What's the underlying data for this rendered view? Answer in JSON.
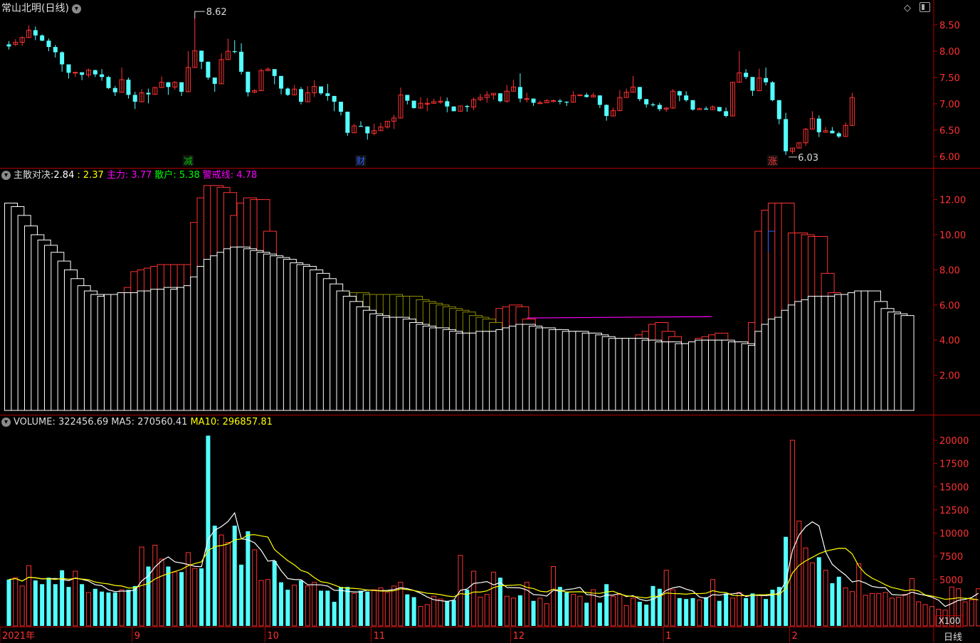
{
  "window": {
    "stock_title": "常山北明(日线)",
    "period_label": "日线",
    "scale_label": "X100"
  },
  "colors": {
    "up": "#ff3232",
    "down": "#54ffff",
    "grid": "#b00000",
    "white": "#ffffff",
    "yellow": "#ffff00",
    "magenta": "#ff00ff",
    "olive": "#8b8b00"
  },
  "price_panel": {
    "high_marker": "8.62",
    "low_marker": "6.03",
    "axis_ticks": [
      "8.50",
      "8.00",
      "7.50",
      "7.00",
      "6.50",
      "6.00"
    ],
    "event_labels": [
      {
        "text": "减",
        "color": "#00c000"
      },
      {
        "text": "财",
        "color": "#3060ff"
      },
      {
        "text": "涨",
        "color": "#ff3232"
      }
    ],
    "candles": [
      [
        8.13,
        8.09,
        8.19,
        8.03
      ],
      [
        8.13,
        8.17,
        8.23,
        8.1
      ],
      [
        8.17,
        8.26,
        8.28,
        8.1
      ],
      [
        8.26,
        8.4,
        8.49,
        8.36
      ],
      [
        8.4,
        8.3,
        8.47,
        8.21
      ],
      [
        8.3,
        8.2,
        8.32,
        8.19
      ],
      [
        8.2,
        8.08,
        8.24,
        8.0
      ],
      [
        8.08,
        7.98,
        8.12,
        7.88
      ],
      [
        7.98,
        7.75,
        8.0,
        7.61
      ],
      [
        7.75,
        7.59,
        7.73,
        7.48
      ],
      [
        7.59,
        7.6,
        7.61,
        7.51
      ],
      [
        7.6,
        7.55,
        7.58,
        7.45
      ],
      [
        7.55,
        7.64,
        7.67,
        7.5
      ],
      [
        7.64,
        7.56,
        7.65,
        7.51
      ],
      [
        7.56,
        7.51,
        7.66,
        7.44
      ],
      [
        7.51,
        7.3,
        7.53,
        7.28
      ],
      [
        7.3,
        7.22,
        7.34,
        7.15
      ],
      [
        7.22,
        7.46,
        7.69,
        7.43
      ],
      [
        7.46,
        7.17,
        7.5,
        7.1
      ],
      [
        7.17,
        7.04,
        7.23,
        6.9
      ],
      [
        7.04,
        7.21,
        7.28,
        7.03
      ],
      [
        7.21,
        7.18,
        7.29,
        7.01
      ],
      [
        7.18,
        7.31,
        7.32,
        7.24
      ],
      [
        7.31,
        7.41,
        7.52,
        7.43
      ],
      [
        7.41,
        7.32,
        7.37,
        7.17
      ],
      [
        7.32,
        7.41,
        7.43,
        7.27
      ],
      [
        7.41,
        7.23,
        7.35,
        7.15
      ],
      [
        7.23,
        7.69,
        8.0,
        7.61
      ],
      [
        7.69,
        8.01,
        8.62,
        7.92
      ],
      [
        8.01,
        7.8,
        7.94,
        7.66
      ],
      [
        7.8,
        7.5,
        7.77,
        7.46
      ],
      [
        7.5,
        7.38,
        7.49,
        7.23
      ],
      [
        7.38,
        7.84,
        7.96,
        7.81
      ],
      [
        7.84,
        8.0,
        8.24,
        7.97
      ],
      [
        8.0,
        7.99,
        8.21,
        7.96
      ],
      [
        7.99,
        7.61,
        8.15,
        7.56
      ],
      [
        7.61,
        7.22,
        7.54,
        7.14
      ],
      [
        7.22,
        7.25,
        7.28,
        7.2
      ],
      [
        7.25,
        7.63,
        7.67,
        7.45
      ],
      [
        7.63,
        7.66,
        7.69,
        7.65
      ],
      [
        7.66,
        7.53,
        7.6,
        7.37
      ],
      [
        7.53,
        7.29,
        7.49,
        7.18
      ],
      [
        7.29,
        7.17,
        7.31,
        7.15
      ],
      [
        7.17,
        7.28,
        7.36,
        7.26
      ],
      [
        7.28,
        7.04,
        7.32,
        6.99
      ],
      [
        7.04,
        7.21,
        7.34,
        7.06
      ],
      [
        7.21,
        7.33,
        7.45,
        7.13
      ],
      [
        7.33,
        7.2,
        7.26,
        7.17
      ],
      [
        7.2,
        7.15,
        7.38,
        7.06
      ],
      [
        7.15,
        7.04,
        7.13,
        6.86
      ],
      [
        7.04,
        6.85,
        7.02,
        6.78
      ],
      [
        6.85,
        6.45,
        6.63,
        6.39
      ],
      [
        6.45,
        6.58,
        6.62,
        6.46
      ],
      [
        6.58,
        6.57,
        6.67,
        6.57
      ],
      [
        6.57,
        6.44,
        6.52,
        6.32
      ],
      [
        6.44,
        6.49,
        6.62,
        6.4
      ],
      [
        6.49,
        6.56,
        6.64,
        6.54
      ],
      [
        6.56,
        6.67,
        6.67,
        6.53
      ],
      [
        6.67,
        6.73,
        6.79,
        6.52
      ],
      [
        6.73,
        7.17,
        7.31,
        6.79
      ],
      [
        7.17,
        7.06,
        7.12,
        6.99
      ],
      [
        7.06,
        6.92,
        7.01,
        6.91
      ],
      [
        6.92,
        7.01,
        7.13,
        6.91
      ],
      [
        7.01,
        7.01,
        7.11,
        6.86
      ],
      [
        7.01,
        7.04,
        7.1,
        7.02
      ],
      [
        7.04,
        7.05,
        7.14,
        7.0
      ],
      [
        7.05,
        6.95,
        7.12,
        6.84
      ],
      [
        6.95,
        6.86,
        6.94,
        6.87
      ],
      [
        6.86,
        6.96,
        6.95,
        6.88
      ],
      [
        6.96,
        6.94,
        6.98,
        6.85
      ],
      [
        6.94,
        7.08,
        7.12,
        6.88
      ],
      [
        7.08,
        7.12,
        7.19,
        7.05
      ],
      [
        7.12,
        7.17,
        7.24,
        7.02
      ],
      [
        7.17,
        7.2,
        7.19,
        7.08
      ],
      [
        7.2,
        7.05,
        7.19,
        7.03
      ],
      [
        7.05,
        7.24,
        7.36,
        7.02
      ],
      [
        7.24,
        7.32,
        7.46,
        7.25
      ],
      [
        7.32,
        7.1,
        7.58,
        7.03
      ],
      [
        7.1,
        7.1,
        7.21,
        7.03
      ],
      [
        7.1,
        7.02,
        7.09,
        6.96
      ],
      [
        7.02,
        7.02,
        7.06,
        7.03
      ],
      [
        7.02,
        7.06,
        7.09,
        7.06
      ],
      [
        7.06,
        7.06,
        7.08,
        7.03
      ],
      [
        7.06,
        7.04,
        7.09,
        6.99
      ],
      [
        7.04,
        7.03,
        7.05,
        6.96
      ],
      [
        7.03,
        7.16,
        7.24,
        7.04
      ],
      [
        7.16,
        7.17,
        7.18,
        7.15
      ],
      [
        7.17,
        7.13,
        7.21,
        7.12
      ],
      [
        7.13,
        7.16,
        7.21,
        7.14
      ],
      [
        7.16,
        6.98,
        7.11,
        6.92
      ],
      [
        6.98,
        6.77,
        6.99,
        6.68
      ],
      [
        6.77,
        6.87,
        6.93,
        6.83
      ],
      [
        6.87,
        7.12,
        7.26,
        6.87
      ],
      [
        7.12,
        7.22,
        7.29,
        7.19
      ],
      [
        7.22,
        7.32,
        7.53,
        7.25
      ],
      [
        7.32,
        7.09,
        7.32,
        7.05
      ],
      [
        7.09,
        6.99,
        7.03,
        6.93
      ],
      [
        6.99,
        6.98,
        7.02,
        6.95
      ],
      [
        6.98,
        6.9,
        7.02,
        6.86
      ],
      [
        6.9,
        6.92,
        6.94,
        6.85
      ],
      [
        6.92,
        7.24,
        7.28,
        6.91
      ],
      [
        7.24,
        7.16,
        7.25,
        7.05
      ],
      [
        7.16,
        7.07,
        7.24,
        7.04
      ],
      [
        7.07,
        6.89,
        7.01,
        6.87
      ],
      [
        6.89,
        6.91,
        6.93,
        6.9
      ],
      [
        6.91,
        6.89,
        6.95,
        6.89
      ],
      [
        6.89,
        6.94,
        6.97,
        6.9
      ],
      [
        6.94,
        6.86,
        6.92,
        6.85
      ],
      [
        6.86,
        6.77,
        6.93,
        6.74
      ],
      [
        6.77,
        7.41,
        7.41,
        6.82
      ],
      [
        7.41,
        7.59,
        8.0,
        7.49
      ],
      [
        7.59,
        7.51,
        7.66,
        7.47
      ],
      [
        7.51,
        7.25,
        7.4,
        7.15
      ],
      [
        7.25,
        7.49,
        7.67,
        7.38
      ],
      [
        7.49,
        7.41,
        7.69,
        7.35
      ],
      [
        7.41,
        7.07,
        7.43,
        7.05
      ],
      [
        7.07,
        6.71,
        6.99,
        6.61
      ],
      [
        6.71,
        6.1,
        6.83,
        6.03
      ],
      [
        6.1,
        6.16,
        6.14,
        6.05
      ],
      [
        6.16,
        6.26,
        6.23,
        6.17
      ],
      [
        6.26,
        6.52,
        6.54,
        6.2
      ],
      [
        6.52,
        6.72,
        6.86,
        6.57
      ],
      [
        6.72,
        6.46,
        6.78,
        6.37
      ],
      [
        6.46,
        6.49,
        6.56,
        6.46
      ],
      [
        6.49,
        6.44,
        6.56,
        6.45
      ],
      [
        6.44,
        6.38,
        6.47,
        6.35
      ],
      [
        6.38,
        6.59,
        6.65,
        6.39
      ],
      [
        6.59,
        7.12,
        7.21,
        6.91
      ]
    ]
  },
  "indicator_panel": {
    "title": "主散对决",
    "value0": ":2.84",
    "value1": ": 2.37",
    "zhuli_label": "主力",
    "zhuli_value": ": 3.77",
    "sanhu_label": "散户",
    "sanhu_value": ": 5.38",
    "jingjie_label": "警戒线",
    "jingjie_value": ": 4.78",
    "axis_ticks": [
      "12.00",
      "10.00",
      "8.00",
      "6.00",
      "4.00",
      "2.00"
    ],
    "white_series": [
      11.8,
      11.6,
      11.1,
      10.5,
      10.0,
      9.7,
      9.4,
      9.0,
      8.5,
      8.0,
      7.5,
      7.1,
      6.8,
      6.6,
      6.5,
      6.6,
      6.6,
      6.7,
      6.7,
      6.7,
      6.8,
      6.8,
      6.9,
      6.9,
      7.0,
      6.9,
      7.0,
      7.1,
      7.6,
      8.2,
      8.6,
      8.8,
      9.0,
      9.2,
      9.3,
      9.3,
      9.2,
      9.1,
      9.0,
      8.9,
      8.8,
      8.7,
      8.6,
      8.4,
      8.3,
      8.2,
      8.0,
      7.8,
      7.5,
      7.2,
      6.8,
      6.5,
      6.2,
      5.9,
      5.7,
      5.5,
      5.4,
      5.3,
      5.3,
      5.3,
      5.2,
      5.0,
      4.9,
      4.8,
      4.7,
      4.7,
      4.6,
      4.5,
      4.4,
      4.4,
      4.4,
      4.5,
      4.5,
      4.5,
      4.6,
      4.7,
      4.8,
      4.9,
      4.9,
      4.8,
      4.7,
      4.7,
      4.6,
      4.6,
      4.5,
      4.5,
      4.5,
      4.4,
      4.4,
      4.3,
      4.2,
      4.1,
      4.1,
      4.1,
      4.1,
      4.1,
      4.0,
      4.0,
      3.9,
      3.9,
      3.9,
      3.8,
      3.8,
      3.9,
      4.0,
      4.0,
      4.0,
      4.0,
      4.0,
      3.9,
      3.9,
      3.8,
      3.7,
      4.5,
      4.9,
      5.2,
      5.3,
      5.7,
      6.0,
      6.2,
      6.3,
      6.5,
      6.5,
      6.5,
      6.5,
      6.6,
      6.6,
      6.7,
      6.8,
      6.8,
      6.8,
      6.2,
      5.8,
      5.6,
      5.5,
      5.4
    ],
    "red_series": [
      0,
      0,
      0,
      0,
      0,
      0,
      0,
      0,
      0,
      0,
      0,
      0,
      0,
      0,
      0,
      0,
      0,
      0,
      7.0,
      7.9,
      8.0,
      8.1,
      8.2,
      8.3,
      8.3,
      8.3,
      8.3,
      8.3,
      10.7,
      12.1,
      12.8,
      12.8,
      12.7,
      12.4,
      11.1,
      11.8,
      12.1,
      12.0,
      12.0,
      10.2,
      0,
      0,
      0,
      0,
      0,
      0,
      0,
      0,
      0,
      0,
      0,
      0,
      0,
      0,
      0,
      0,
      0,
      0,
      0,
      0,
      0,
      6.2,
      6.1,
      5.8,
      5.6,
      5.3,
      5.2,
      5.0,
      4.9,
      4.8,
      4.7,
      4.7,
      4.8,
      4.9,
      5.8,
      5.9,
      6.0,
      5.9,
      5.2,
      0,
      0,
      0,
      0,
      0,
      0,
      0,
      0,
      0,
      0,
      0,
      0,
      0,
      0,
      0,
      0,
      4.3,
      4.5,
      4.9,
      5.0,
      4.5,
      4.2,
      0,
      0,
      0,
      4.1,
      4.2,
      4.3,
      4.4,
      0,
      0,
      0,
      0,
      5.0,
      10.2,
      11.4,
      11.8,
      11.8,
      11.8,
      10.1,
      10.1,
      10.0,
      9.9,
      9.9,
      7.8,
      6.7,
      0,
      0,
      0,
      0,
      0,
      0,
      0,
      0,
      0
    ],
    "olive_series": [
      0,
      0,
      0,
      0,
      0,
      0,
      0,
      0,
      0,
      0,
      0,
      0,
      0,
      0,
      0,
      0,
      0,
      0,
      0,
      0,
      0,
      0,
      0,
      0,
      0,
      0,
      0,
      0,
      0,
      0,
      0,
      0,
      0,
      0,
      0,
      0,
      0,
      0,
      0,
      0,
      0,
      0,
      0,
      0,
      0,
      0,
      0,
      0,
      0,
      6.8,
      6.7,
      6.7,
      6.7,
      6.7,
      6.6,
      6.6,
      6.6,
      6.6,
      6.6,
      6.5,
      6.5,
      6.5,
      6.3,
      6.2,
      6.1,
      6.0,
      5.9,
      5.8,
      5.7,
      5.6,
      5.4,
      5.3,
      5.2,
      5.0,
      0,
      0,
      0,
      0,
      0,
      0,
      0,
      0,
      0,
      0,
      0,
      0,
      0,
      0,
      0,
      0,
      0,
      0,
      0,
      0,
      0,
      0,
      0,
      0,
      0,
      0,
      0,
      0,
      0,
      0,
      0,
      0,
      0,
      0,
      0,
      0,
      0,
      0,
      0,
      0,
      0,
      0,
      0,
      0,
      0,
      0,
      0,
      0,
      0,
      0,
      0,
      0,
      0,
      0,
      0,
      0,
      0,
      0,
      0,
      0,
      0
    ],
    "warning_line": {
      "value": 5.3,
      "from_index": 78,
      "to_index": 105
    }
  },
  "volume_panel": {
    "label": "VOLUME",
    "value": ": 322456.69",
    "ma5_label": "MA5",
    "ma5_value": ": 270560.41",
    "ma10_label": "MA10",
    "ma10_value": ": 296857.81",
    "axis_ticks": [
      "20000",
      "17500",
      "15000",
      "12500",
      "10000",
      "7500",
      "5000"
    ],
    "volumes": [
      5000,
      5200,
      4300,
      6500,
      4900,
      4500,
      5200,
      4500,
      6000,
      4200,
      5900,
      4500,
      3600,
      4000,
      3700,
      3600,
      3600,
      3900,
      3900,
      4300,
      8500,
      6400,
      8700,
      7200,
      6400,
      5800,
      5800,
      7900,
      6200,
      6200,
      20500,
      10800,
      9800,
      9000,
      10800,
      6600,
      10200,
      8200,
      4900,
      5000,
      7000,
      4700,
      3900,
      4400,
      4900,
      4300,
      4700,
      3800,
      3800,
      2600,
      4200,
      4200,
      3500,
      3800,
      3700,
      3900,
      4100,
      3600,
      4300,
      4700,
      3400,
      3100,
      2100,
      2300,
      3200,
      2900,
      2700,
      2800,
      7600,
      3900,
      5900,
      3100,
      3400,
      5800,
      5200,
      3200,
      3000,
      3300,
      4700,
      2700,
      3000,
      2400,
      6400,
      4200,
      3600,
      3400,
      3200,
      2500,
      3900,
      2500,
      4500,
      3200,
      3400,
      2200,
      3000,
      2600,
      2300,
      4300,
      4000,
      6000,
      3900,
      3000,
      2900,
      3000,
      2800,
      3100,
      5000,
      2700,
      3500,
      3000,
      3600,
      3000,
      3500,
      3300,
      2900,
      3900,
      4200,
      9600,
      20000,
      11300,
      8400,
      6800,
      7400,
      6000,
      4600,
      5300,
      4100,
      3700,
      6700,
      3300,
      3500,
      3500,
      3600,
      3000,
      3100,
      3400,
      5100,
      2600,
      2300,
      2100,
      1800,
      1700,
      4200,
      4000,
      2600,
      2800,
      4000
    ]
  },
  "x_axis": {
    "labels": [
      {
        "text": "2021年",
        "index": 0
      },
      {
        "text": "9",
        "index": 19
      },
      {
        "text": "10",
        "index": 39
      },
      {
        "text": "11",
        "index": 55
      },
      {
        "text": "12",
        "index": 76
      },
      {
        "text": "1",
        "index": 99
      },
      {
        "text": "2",
        "index": 118
      }
    ]
  }
}
